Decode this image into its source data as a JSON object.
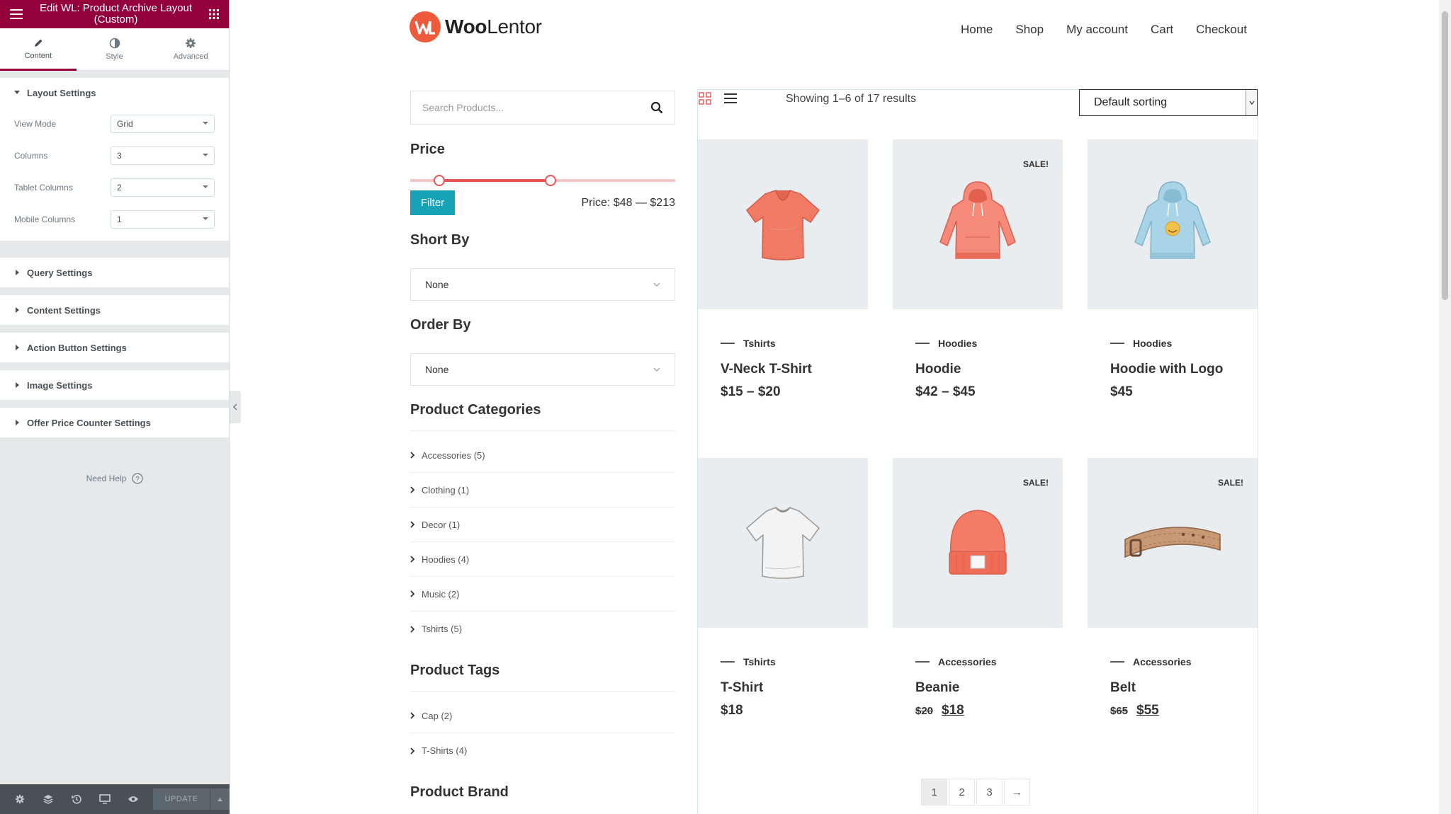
{
  "editor": {
    "title": "Edit WL: Product Archive Layout (Custom)",
    "tabs": [
      {
        "label": "Content",
        "icon": "pencil-icon"
      },
      {
        "label": "Style",
        "icon": "contrast-icon"
      },
      {
        "label": "Advanced",
        "icon": "gear-icon"
      }
    ],
    "layout_section": {
      "title": "Layout Settings",
      "controls": [
        {
          "label": "View Mode",
          "value": "Grid"
        },
        {
          "label": "Columns",
          "value": "3"
        },
        {
          "label": "Tablet Columns",
          "value": "2"
        },
        {
          "label": "Mobile Columns",
          "value": "1"
        }
      ]
    },
    "collapsed_sections": [
      "Query Settings",
      "Content Settings",
      "Action Button Settings",
      "Image Settings",
      "Offer Price Counter Settings"
    ],
    "need_help": "Need Help",
    "update_label": "UPDATE",
    "accent_color": "#93003c"
  },
  "site": {
    "logo_brand": "Woo",
    "logo_rest": "Lentor",
    "nav": [
      "Home",
      "Shop",
      "My account",
      "Cart",
      "Checkout"
    ]
  },
  "sidebar": {
    "search_placeholder": "Search Products...",
    "price_title": "Price",
    "price_slider": {
      "min_fraction": 0.11,
      "max_fraction": 0.53
    },
    "filter_label": "Filter",
    "price_range_text": "Price: $48 — $213",
    "short_by_title": "Short By",
    "short_by_value": "None",
    "order_by_title": "Order By",
    "order_by_value": "None",
    "categories_title": "Product Categories",
    "categories": [
      "Accessories (5)",
      "Clothing (1)",
      "Decor (1)",
      "Hoodies (4)",
      "Music (2)",
      "Tshirts (5)"
    ],
    "tags_title": "Product Tags",
    "tags": [
      "Cap (2)",
      "T-Shirts (4)"
    ],
    "brand_title": "Product Brand"
  },
  "shop": {
    "results_text": "Showing 1–6 of 17 results",
    "sorting_value": "Default sorting",
    "products": [
      {
        "category": "Tshirts",
        "title": "V-Neck T-Shirt",
        "price": "$15 – $20",
        "old_price": "",
        "sale": "",
        "image": "vneck-tshirt-image"
      },
      {
        "category": "Hoodies",
        "title": "Hoodie",
        "price": "$42 – $45",
        "old_price": "",
        "sale": "SALE!",
        "image": "hoodie-image"
      },
      {
        "category": "Hoodies",
        "title": "Hoodie with Logo",
        "price": "$45",
        "old_price": "",
        "sale": "",
        "image": "hoodie-logo-image"
      },
      {
        "category": "Tshirts",
        "title": "T-Shirt",
        "price": "$18",
        "old_price": "",
        "sale": "",
        "image": "tshirt-image"
      },
      {
        "category": "Accessories",
        "title": "Beanie",
        "price": "$18",
        "old_price": "$20",
        "sale": "SALE!",
        "image": "beanie-image"
      },
      {
        "category": "Accessories",
        "title": "Belt",
        "price": "$55",
        "old_price": "$65",
        "sale": "SALE!",
        "image": "belt-image"
      }
    ],
    "pagination": [
      "1",
      "2",
      "3",
      "→"
    ],
    "current_page": "1"
  }
}
